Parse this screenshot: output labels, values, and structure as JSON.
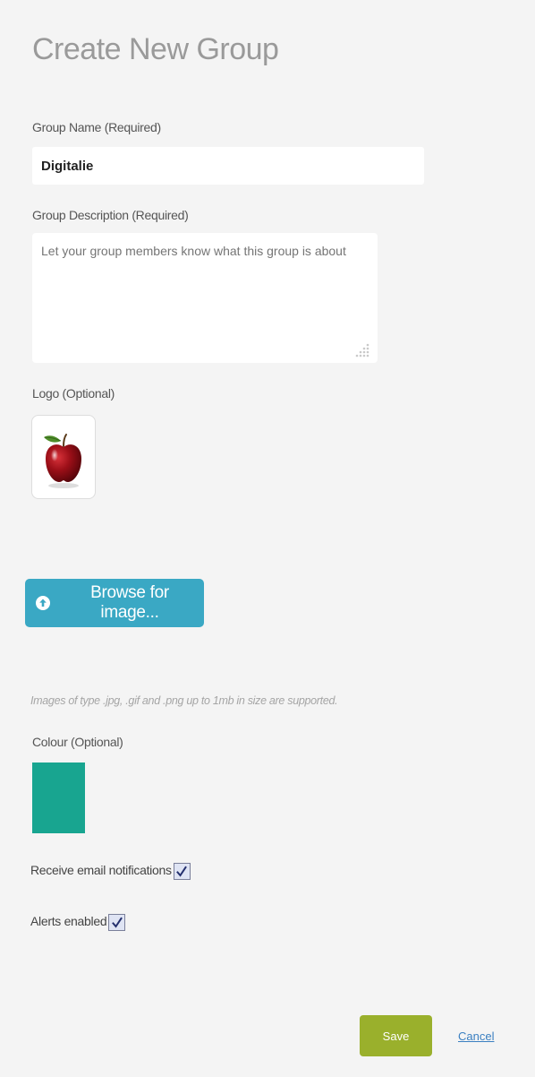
{
  "page": {
    "title": "Create New Group"
  },
  "form": {
    "group_name": {
      "label": "Group Name (Required)",
      "value": "Digitalie"
    },
    "group_description": {
      "label": "Group Description (Required)",
      "placeholder": "Let your group members know what this group is about"
    },
    "logo": {
      "label": "Logo (Optional)",
      "image_icon": "apple-image"
    },
    "browse": {
      "label": "Browse for image...",
      "icon": "upload-circle-icon"
    },
    "hint": "Images of type .jpg, .gif and .png up to 1mb in size are supported.",
    "colour": {
      "label": "Colour (Optional)",
      "value": "#18a590"
    },
    "email_notifications": {
      "label": "Receive email notifications",
      "checked": true
    },
    "alerts": {
      "label": "Alerts enabled",
      "checked": true
    }
  },
  "actions": {
    "save_label": "Save",
    "cancel_label": "Cancel"
  },
  "colors": {
    "browse_button": "#3aa8c4",
    "save_button": "#9ab02c",
    "cancel_link": "#3a7fc1",
    "title": "#9a9a9a"
  }
}
